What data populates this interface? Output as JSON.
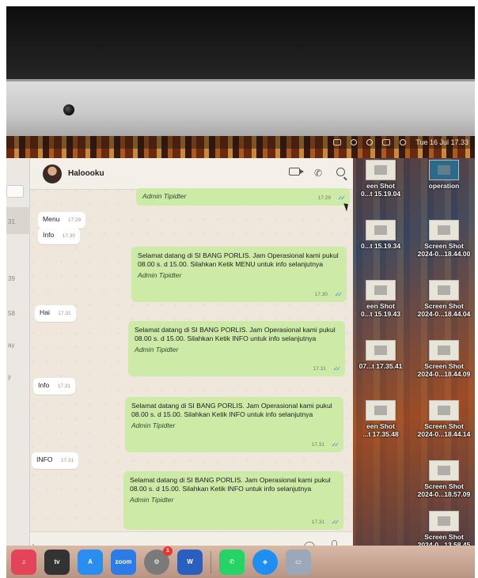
{
  "menubar": {
    "datetime": "Tue 16 Jul 17.33"
  },
  "sidebar": {
    "times": [
      "31",
      "39",
      "58",
      "ay",
      "y"
    ]
  },
  "chat": {
    "contact_name": "Haloooku",
    "messages": [
      {
        "dir": "out",
        "text": "",
        "sender": "Admin Tipidter",
        "time": "17.29"
      },
      {
        "dir": "in",
        "text": "Menu",
        "time": "17.29"
      },
      {
        "dir": "in",
        "text": "Info",
        "time": "17.30"
      },
      {
        "dir": "out",
        "text": "Selamat datang di SI BANG PORLIS. Jam Operasional kami pukul 08.00 s. d 15.00. Silahkan Ketik MENU untuk info selanjutnya",
        "sender": "Admin Tipidter",
        "time": "17.30"
      },
      {
        "dir": "in",
        "text": "Hai",
        "time": "17.31"
      },
      {
        "dir": "out",
        "text": "Selamat datang di SI BANG PORLIS. Jam Operasional kami pukul 08.00 s. d 15.00. Silahkan Ketik INFO untuk info selanjutnya",
        "sender": "Admin Tipidter",
        "time": "17.31"
      },
      {
        "dir": "in",
        "text": "Info",
        "time": "17.31"
      },
      {
        "dir": "out",
        "text": "Selamat datang di SI BANG PORLIS. Jam Operasional kami pukul 08.00 s. d 15.00. Silahkan Ketik INFO untuk info selanjutnya",
        "sender": "Admin Tipidter",
        "time": "17.31"
      },
      {
        "dir": "in",
        "text": "INFO",
        "time": "17.31"
      },
      {
        "dir": "out",
        "text": "Selamat datang di SI BANG PORLIS. Jam Operasional kami pukul 08.00 s. d 15.00. Silahkan Ketik INFO untuk info selanjutnya",
        "sender": "Admin Tipidter",
        "time": "17.31"
      }
    ]
  },
  "desktop": {
    "items": [
      {
        "line1": "een Shot",
        "line2": "0...t 15.19.04"
      },
      {
        "line1": "operation",
        "line2": ""
      },
      {
        "line1": "",
        "line2": "0...t 15.19.34"
      },
      {
        "line1": "Screen Shot",
        "line2": "2024-0...18.44.00"
      },
      {
        "line1": "een Shot",
        "line2": "0...t 15.19.43"
      },
      {
        "line1": "Screen Shot",
        "line2": "2024-0...18.44.04"
      },
      {
        "line1": "",
        "line2": "07...t 17.35.41"
      },
      {
        "line1": "Screen Shot",
        "line2": "2024-0...18.44.09"
      },
      {
        "line1": "een Shot",
        "line2": "...t 17.35.48"
      },
      {
        "line1": "Screen Shot",
        "line2": "2024-0...18.44.14"
      },
      {
        "line1": "Screen Shot",
        "line2": "2024-0...18.57.09"
      },
      {
        "line1": "Screen Shot",
        "line2": "2024-0...13.58.45"
      }
    ]
  },
  "dock": {
    "zoom_label": "zoom",
    "tv_label": "tv",
    "badge_count": "1",
    "word_label": "W"
  }
}
